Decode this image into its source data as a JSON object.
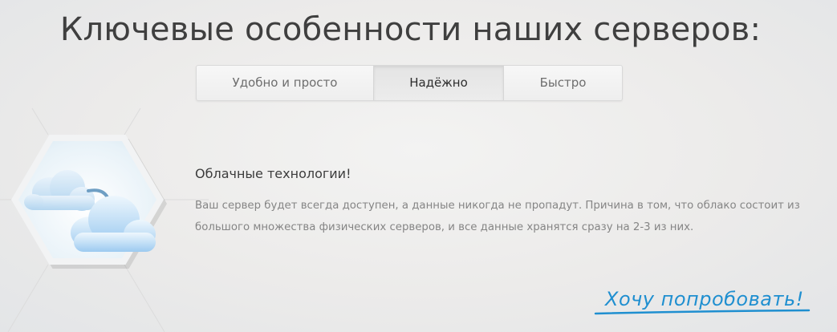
{
  "page": {
    "title": "Ключевые особенности наших серверов:"
  },
  "tabs": [
    {
      "label": "Удобно и просто",
      "active": false
    },
    {
      "label": "Надёжно",
      "active": true
    },
    {
      "label": "Быстро",
      "active": false
    }
  ],
  "feature": {
    "icon": "cloud-sync-icon",
    "title": "Облачные технологии!",
    "text": "Ваш сервер будет всегда доступен, а данные никогда не пропадут. Причина в том, что облако состоит из большого множества физических серверов, и все данные хранятся сразу на 2-3 из них."
  },
  "cta": {
    "label": "Хочу попробовать!",
    "color": "#1f8fd0"
  }
}
